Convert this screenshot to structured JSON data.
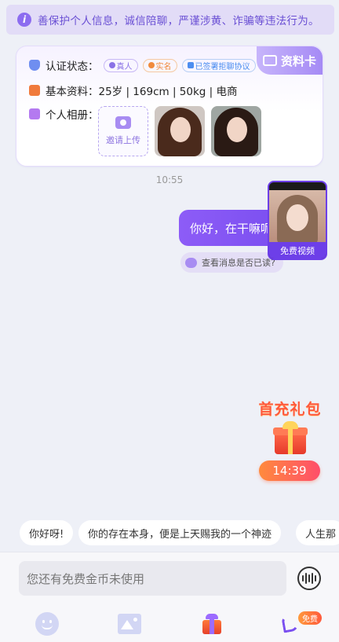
{
  "notice": {
    "text": "善保护个人信息，诚信陪聊，严谨涉黄、诈骗等违法行为。"
  },
  "profile_card": {
    "tag_label": "资料卡",
    "verify_label": "认证状态：",
    "badges": [
      {
        "label": "真人",
        "color": "#8a72e6"
      },
      {
        "label": "实名",
        "color": "#f08a3c"
      },
      {
        "label": "已签署拒聊协议",
        "color": "#4d8ef0"
      }
    ],
    "info_label": "基本资料：",
    "info_value": "25岁 | 169cm | 50kg | 电商",
    "album_label": "个人相册：",
    "upload_label": "邀请上传"
  },
  "chat": {
    "time": "10:55",
    "message": "你好，在干嘛呢",
    "read_check": "查看消息是否已读?"
  },
  "video_call": {
    "label": "免费视频"
  },
  "promo": {
    "title": "首充礼包",
    "timer": "14:39"
  },
  "quick_replies": [
    "你好呀!",
    "你的存在本身，便是上天赐我的一个神迹",
    "人生那"
  ],
  "composer": {
    "placeholder": "您还有免费金币未使用",
    "free_badge": "免费"
  },
  "colors": {
    "accent": "#7b4ff0",
    "promo": "#ff5a3c"
  }
}
